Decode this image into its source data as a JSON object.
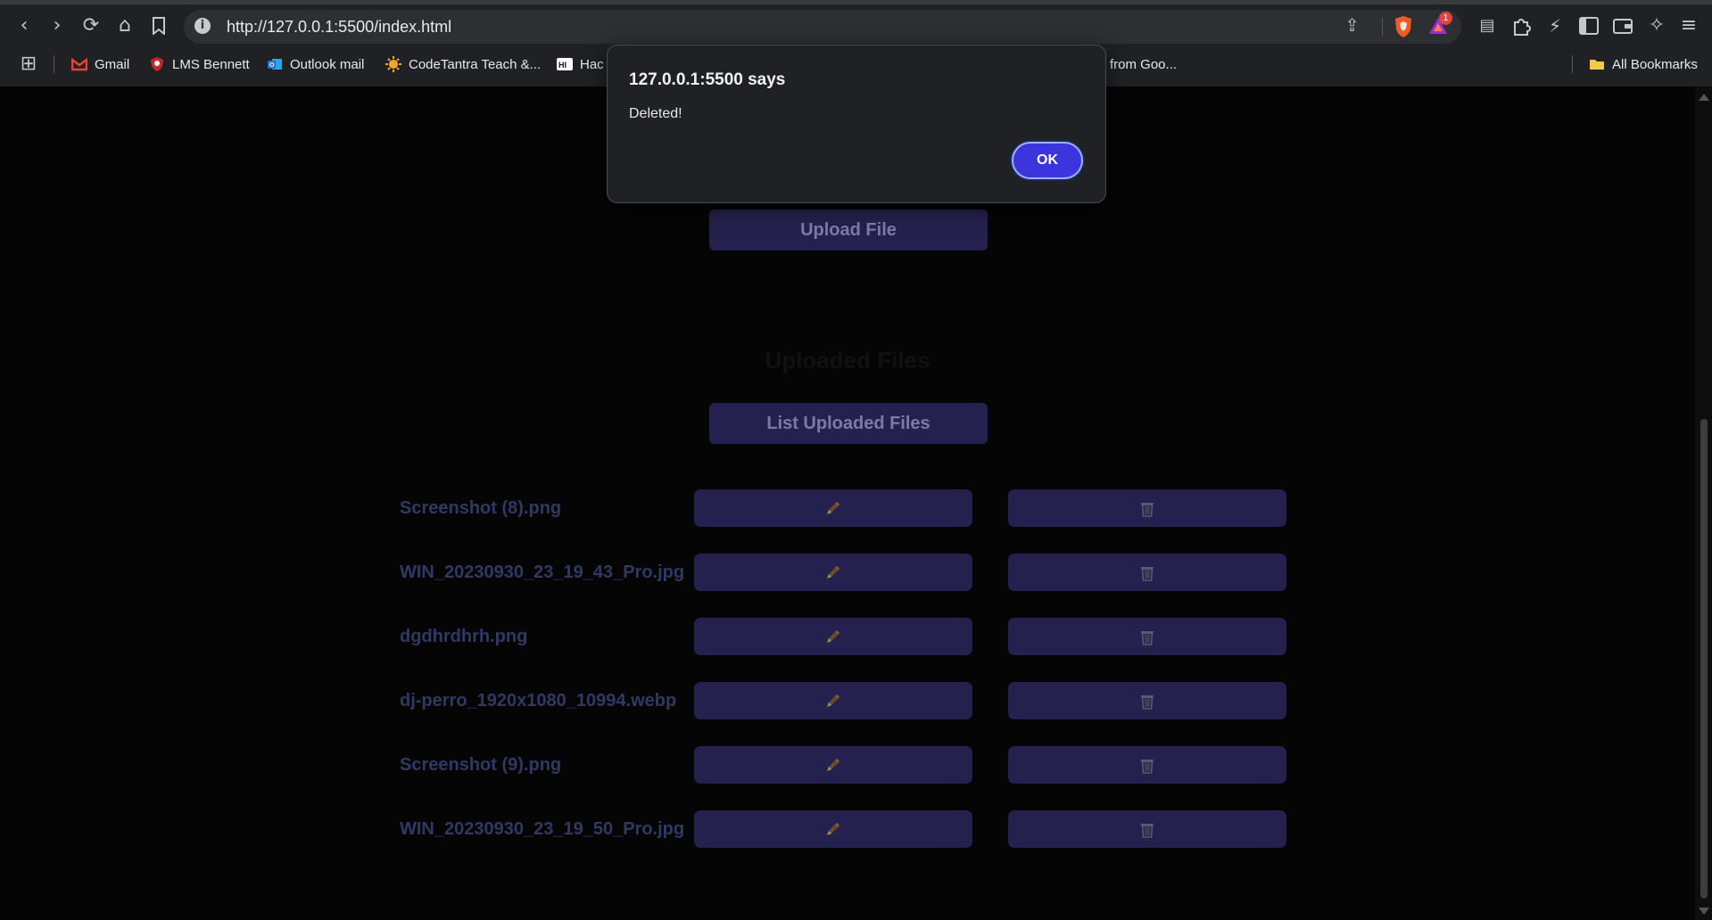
{
  "browser": {
    "url": "http://127.0.0.1:5500/index.html",
    "rewards_badge": "1",
    "bookmarks": [
      {
        "label": "Gmail",
        "icon": "gmail-icon",
        "color": "#ea4335"
      },
      {
        "label": "LMS Bennett",
        "icon": "bennett-icon",
        "color": "#c62828"
      },
      {
        "label": "Outlook mail",
        "icon": "outlook-icon",
        "color": "#1e6fd9"
      },
      {
        "label": "CodeTantra Teach &...",
        "icon": "codetantra-icon",
        "color": "#f5a623"
      },
      {
        "label": "Hac",
        "icon": "hackerrank-icon",
        "color": "#ffffff"
      },
      {
        "label": "from Goo...",
        "icon": "",
        "color": ""
      }
    ],
    "all_bookmarks_label": "All Bookmarks"
  },
  "page": {
    "upload_button": "Upload File",
    "uploaded_title": "Uploaded Files",
    "list_button": "List Uploaded Files",
    "edit_icon": "✏",
    "delete_icon": "🗑",
    "files": [
      {
        "name": "Screenshot (8).png"
      },
      {
        "name": "WIN_20230930_23_19_43_Pro.jpg"
      },
      {
        "name": "dgdhrdhrh.png"
      },
      {
        "name": "dj-perro_1920x1080_10994.webp"
      },
      {
        "name": "Screenshot (9).png"
      },
      {
        "name": "WIN_20230930_23_19_50_Pro.jpg"
      }
    ]
  },
  "dialog": {
    "title": "127.0.0.1:5500 says",
    "message": "Deleted!",
    "ok_label": "OK"
  },
  "colors": {
    "accent": "#3c34dd",
    "button_bg": "#25214e",
    "file_name": "#303963"
  }
}
